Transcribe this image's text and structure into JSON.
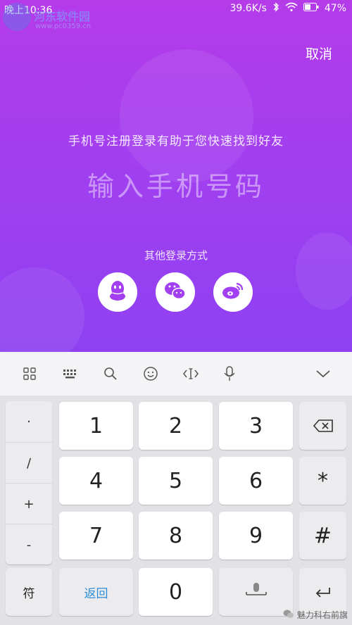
{
  "status_bar": {
    "time": "晚上10:36",
    "network_speed": "39.6K/s",
    "battery": "47%"
  },
  "watermark": {
    "title": "河东软件园",
    "url": "www.pc0359.cn"
  },
  "header": {
    "cancel_label": "取消"
  },
  "login": {
    "hint": "手机号注册登录有助于您快速找到好友",
    "phone_placeholder": "输入手机号码",
    "other_methods_label": "其他登录方式",
    "methods": [
      "qq",
      "wechat",
      "weibo"
    ]
  },
  "keyboard": {
    "toolbar_icons": [
      "grid-icon",
      "keyboard-icon",
      "search-icon",
      "emoji-icon",
      "cursor-icon",
      "microphone-icon",
      "chevron-down-icon"
    ],
    "symbols": [
      "·",
      "/",
      "+",
      "-"
    ],
    "digits": [
      "1",
      "2",
      "3",
      "4",
      "5",
      "6",
      "7",
      "8",
      "9",
      "0"
    ],
    "star": "*",
    "hash": "#",
    "symbol_key": "符",
    "back_key": "返回"
  },
  "corner_watermark": "魅力科右前旗",
  "colors": {
    "accent": "#a23ff0",
    "back_key_text": "#2b8bd6"
  }
}
